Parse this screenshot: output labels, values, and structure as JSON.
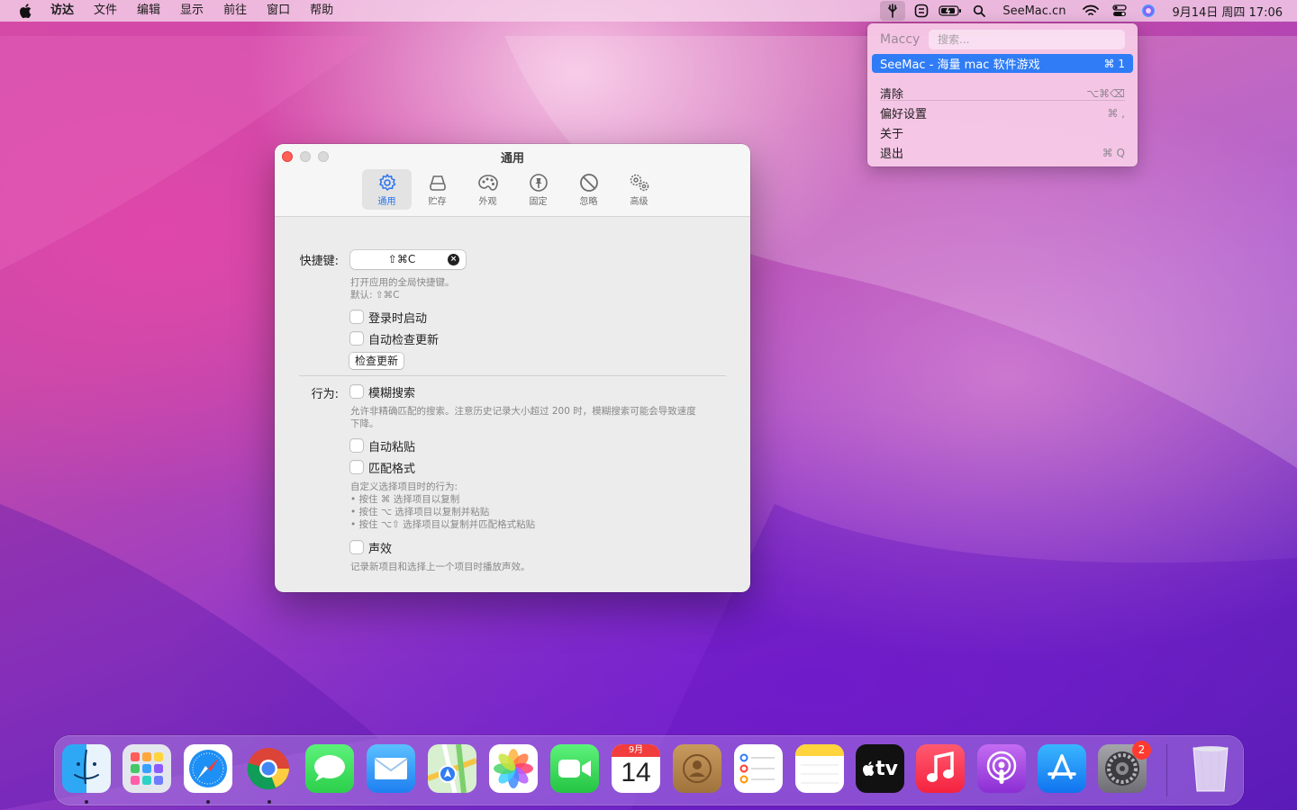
{
  "menubar": {
    "app_name": "访达",
    "menus": [
      "文件",
      "编辑",
      "显示",
      "前往",
      "窗口",
      "帮助"
    ],
    "status_site": "SeeMac.cn",
    "datetime": "9月14日 周四  17:06"
  },
  "maccy": {
    "app_name": "Maccy",
    "search_placeholder": "搜索...",
    "history_item": {
      "label": "SeeMac - 海量 mac 软件游戏",
      "shortcut": "⌘ 1"
    },
    "clear": {
      "label": "清除",
      "shortcut": "⌥⌘⌫"
    },
    "preferences": {
      "label": "偏好设置",
      "shortcut": "⌘ ,"
    },
    "about": {
      "label": "关于"
    },
    "quit": {
      "label": "退出",
      "shortcut": "⌘ Q"
    }
  },
  "window": {
    "title": "通用",
    "tabs": [
      {
        "label": "通用",
        "icon": "gear-icon",
        "active": true
      },
      {
        "label": "贮存",
        "icon": "disk-icon"
      },
      {
        "label": "外观",
        "icon": "palette-icon"
      },
      {
        "label": "固定",
        "icon": "pin-icon"
      },
      {
        "label": "忽略",
        "icon": "prohibited-icon"
      },
      {
        "label": "高级",
        "icon": "gears-icon"
      }
    ],
    "hotkey_label": "快捷键:",
    "hotkey_value": "⇧⌘C",
    "hotkey_hint": "打开应用的全局快捷键。",
    "hotkey_default": "默认: ⇧⌘C",
    "launch_at_login": "登录时启动",
    "auto_update": "自动检查更新",
    "check_updates_button": "检查更新",
    "behavior_label": "行为:",
    "fuzzy_search": "模糊搜索",
    "fuzzy_hint": "允许非精确匹配的搜索。注意历史记录大小超过 200 时，模糊搜索可能会导致速度下降。",
    "auto_paste": "自动粘贴",
    "match_format": "匹配格式",
    "selection_hint_title": "自定义选择项目时的行为:",
    "selection_hint_1": "• 按住 ⌘ 选择项目以复制",
    "selection_hint_2": "• 按住 ⌥ 选择项目以复制并粘贴",
    "selection_hint_3": "• 按住 ⌥⇧ 选择项目以复制并匹配格式粘贴",
    "sound": "声效",
    "sound_hint": "记录新项目和选择上一个项目时播放声效。"
  },
  "dock": {
    "tv_label": "tv",
    "calendar_month": "9月",
    "calendar_day": "14",
    "settings_badge": "2"
  },
  "colors": {
    "accent": "#2f7cf6",
    "close": "#ff5f57"
  }
}
